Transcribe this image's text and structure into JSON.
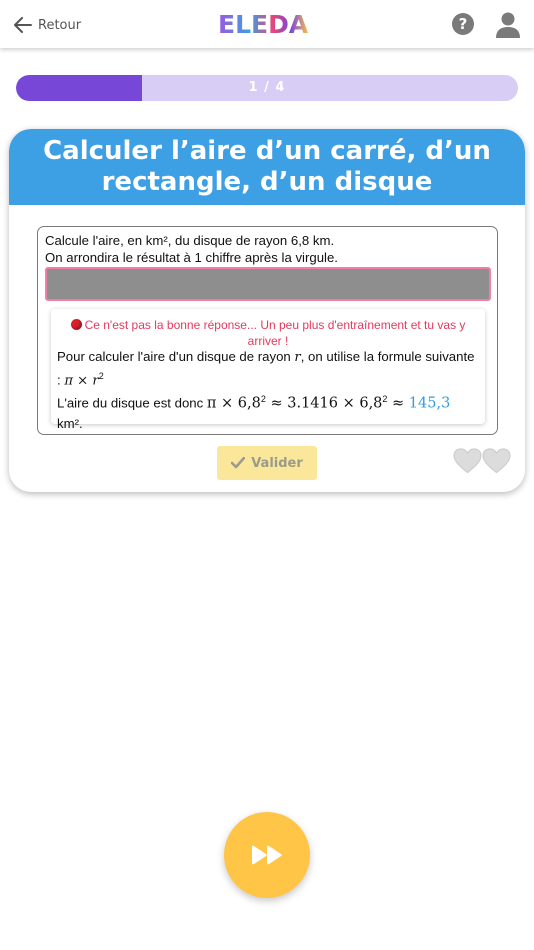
{
  "header": {
    "back_label": "Retour",
    "logo_text": "ELEDA",
    "help_glyph": "?"
  },
  "progress": {
    "label": "1 / 4",
    "fraction": 0.25,
    "fill_color": "#7748d8",
    "track_color": "#d8cdf5"
  },
  "card": {
    "title": "Calculer l’aire d’un carré, d’un rectangle, d’un disque",
    "header_color": "#3d9fe4",
    "question_line1": "Calcule l'aire, en km², du disque de rayon 6,8 km.",
    "question_line2": "On arrondira le résultat à 1 chiffre après la virgule.",
    "answer_value": "",
    "feedback": {
      "error": "Ce n'est pas la bonne réponse... Un peu plus d'entraînement et tu vas y arriver !",
      "explanation_part1": "Pour calculer l'aire d'un disque de rayon ",
      "var_r": "r",
      "explanation_part2": ", on utilise la formule suivante : ",
      "formula": "π × r",
      "exponent": "2",
      "result_intro": "L'aire du disque est donc ",
      "calc_left": "π × 6,8",
      "calc_mid": " ≈ 3.1416 × 6,8",
      "approx": " ≈ ",
      "result": "145,3",
      "unit": "km²."
    },
    "validate_label": "Valider",
    "hearts_count": 2
  },
  "icons": {
    "back": "arrow-left-icon",
    "help": "question-icon",
    "user": "user-icon",
    "check": "check-icon",
    "heart": "heart-icon",
    "skip": "fast-forward-icon"
  }
}
